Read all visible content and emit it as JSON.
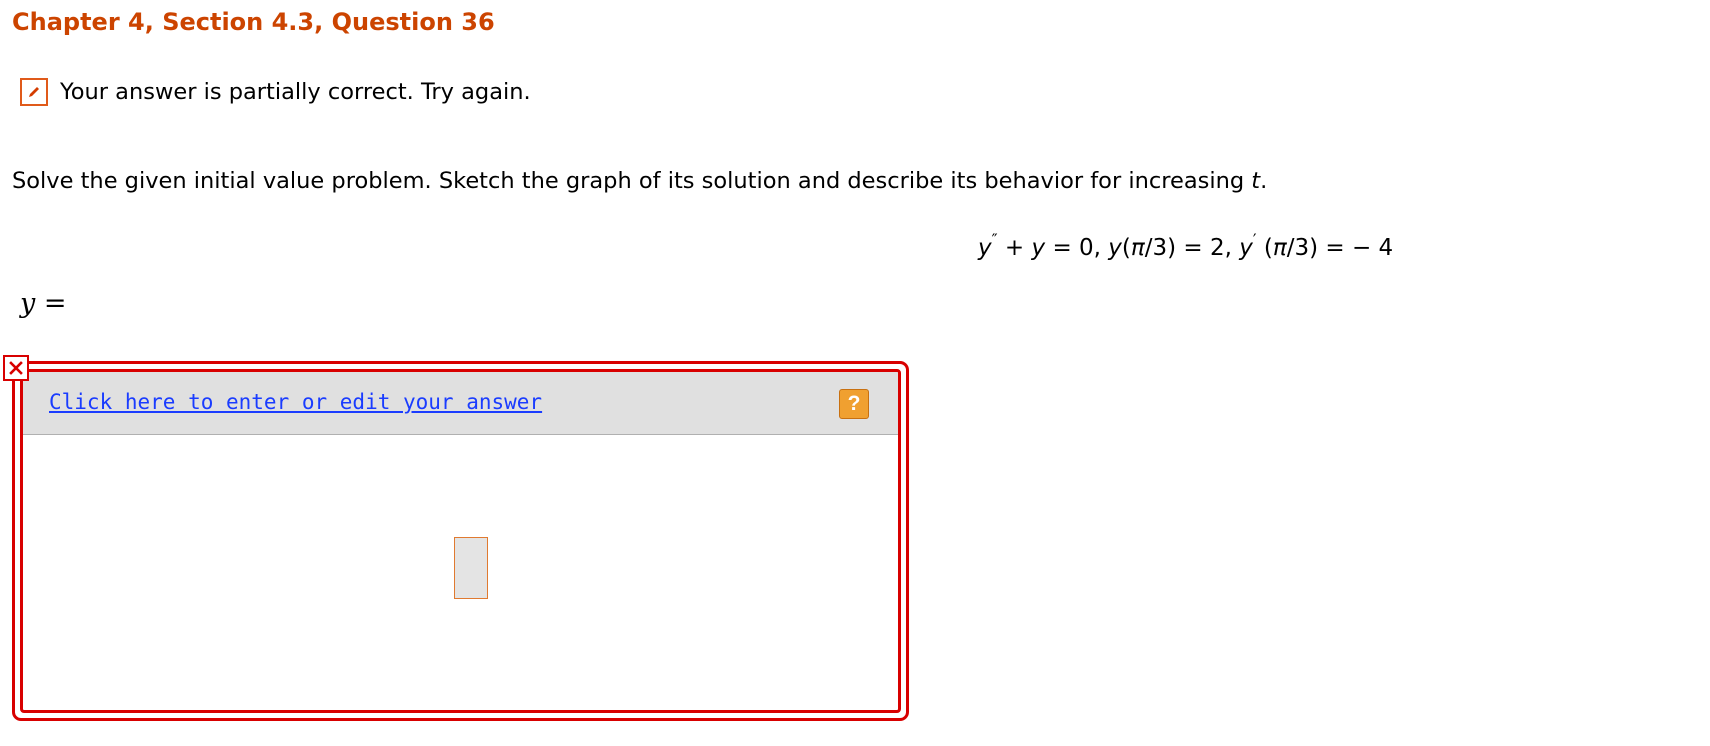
{
  "page": {
    "heading": "Chapter 4, Section 4.3, Question 36",
    "status": {
      "icon": "pencil-icon",
      "message": "Your answer is partially correct.  Try again."
    },
    "problem": {
      "instruction_pre": "Solve the given initial value problem. Sketch the graph of its solution and describe its behavior for increasing ",
      "instruction_var": "t",
      "instruction_post": "."
    },
    "equation": {
      "part1_var": "y",
      "part1_prime": "″",
      "part2": " + ",
      "part3_var": "y",
      "part4": " = 0,  ",
      "part5_var": "y",
      "part6": "(",
      "part7_pi": "π",
      "part8": "/3) = 2,  ",
      "part9_var": "y",
      "part10_prime": "′",
      "part11": " (",
      "part12_pi": "π",
      "part13": "/3)  = − 4"
    },
    "answer_label": {
      "var": "y",
      "equals": " ="
    },
    "answer_box": {
      "error_icon": "close-icon",
      "link_text": "Click here to enter or edit your answer",
      "help_label": "?"
    }
  },
  "colors": {
    "heading": "#cc4400",
    "error_border": "#d80000",
    "link": "#1a3cff",
    "help_button": "#f0a030"
  }
}
